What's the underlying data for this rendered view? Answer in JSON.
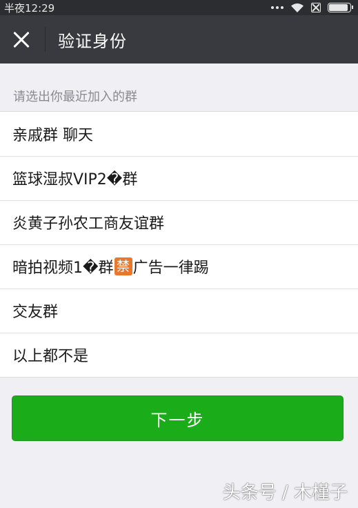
{
  "status_bar": {
    "time": "半夜12:29",
    "icons": [
      "more-dots-icon",
      "wifi-icon",
      "no-sim-icon",
      "battery-icon"
    ],
    "battery_level": 0.9
  },
  "header": {
    "title": "验证身份",
    "close_icon": "close-icon"
  },
  "prompt": "请选出你最近加入的群",
  "options": [
    {
      "label": "亲戚群 聊天"
    },
    {
      "label": "篮球湿叔VIP2�群"
    },
    {
      "label": "炎黄子孙农工商友谊群"
    },
    {
      "label_before": "暗拍视频1�群",
      "badge": "禁",
      "label_after": "广告一律踢"
    },
    {
      "label": "交友群"
    },
    {
      "label": "以上都不是"
    }
  ],
  "next_button": "下一步",
  "watermark": "头条号 / 木槿子",
  "colors": {
    "status_bar": "#2b2d31",
    "title_bar": "#393a3f",
    "background": "#efeff4",
    "primary_button": "#1aad19",
    "badge": "#e8782c"
  }
}
